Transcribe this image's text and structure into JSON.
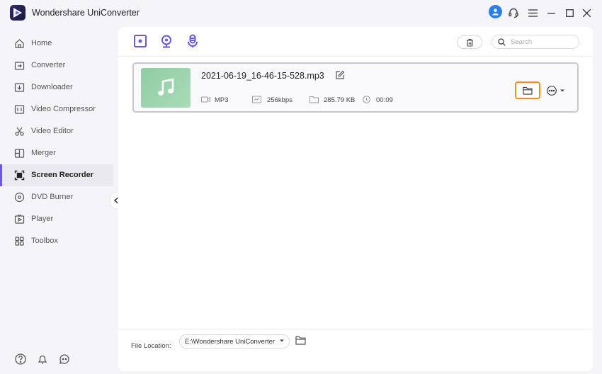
{
  "app": {
    "title": "Wondershare UniConverter"
  },
  "sidebar": {
    "items": [
      {
        "label": "Home",
        "icon": "home-icon"
      },
      {
        "label": "Converter",
        "icon": "converter-icon"
      },
      {
        "label": "Downloader",
        "icon": "downloader-icon"
      },
      {
        "label": "Video Compressor",
        "icon": "compressor-icon"
      },
      {
        "label": "Video Editor",
        "icon": "scissors-icon"
      },
      {
        "label": "Merger",
        "icon": "merger-icon"
      },
      {
        "label": "Screen Recorder",
        "icon": "screen-recorder-icon",
        "active": true
      },
      {
        "label": "DVD Burner",
        "icon": "disc-icon"
      },
      {
        "label": "Player",
        "icon": "player-icon"
      },
      {
        "label": "Toolbox",
        "icon": "toolbox-icon"
      }
    ]
  },
  "toolbar": {
    "search_placeholder": "Search"
  },
  "file": {
    "name": "2021-06-19_16-46-15-528.mp3",
    "format": "MP3",
    "bitrate": "256kbps",
    "size": "285.79 KB",
    "duration": "00:09"
  },
  "footer": {
    "file_location_label": "File Location:",
    "path": "E:\\Wondershare UniConverter"
  },
  "colors": {
    "accent": "#6a5ae0",
    "highlight": "#f08c2c",
    "user": "#2a7ff0"
  }
}
